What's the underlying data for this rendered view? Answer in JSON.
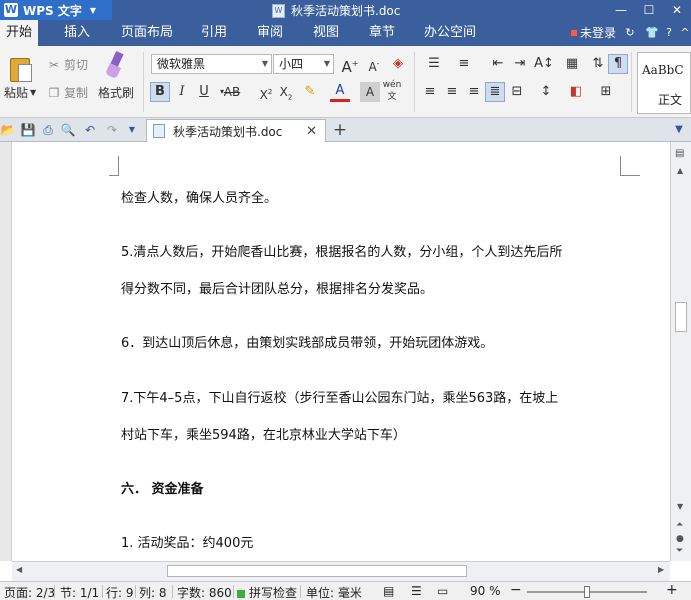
{
  "titlebar": {
    "app_logo": "W",
    "app_name": "WPS 文字",
    "doc_title": "秋季活动策划书.doc",
    "window_controls": [
      "minimize-icon",
      "maximize-icon",
      "close-icon"
    ]
  },
  "menubar": {
    "tabs": [
      "开始",
      "插入",
      "页面布局",
      "引用",
      "审阅",
      "视图",
      "章节",
      "办公空间"
    ],
    "login_label": "未登录"
  },
  "ribbon": {
    "paste_label": "粘贴",
    "cut_label": "剪切",
    "copy_label": "复制",
    "format_painter_label": "格式刷",
    "font_name": "微软雅黑",
    "font_size": "小四",
    "style_sample": "AaBbC",
    "style_name": "正文"
  },
  "document_tab": {
    "title": "秋季活动策划书.doc"
  },
  "document": {
    "paragraphs": [
      "检查人数，确保人员齐全。",
      "5.清点人数后，开始爬香山比赛，根据报名的人数，分小组，个人到达先后所",
      "得分数不同，最后合计团队总分，根据排名分发奖品。",
      "6．到达山顶后休息，由策划实践部成员带领，开始玩团体游戏。",
      "7.下午4–5点，下山自行返校（步行至香山公园东门站，乘坐563路，在坡上",
      "村站下车，乘坐594路，在北京林业大学站下车）",
      "六．  资金准备",
      "1. 活动奖品：约400元"
    ]
  },
  "statusbar": {
    "page": "页面: 2/3",
    "section": "节: 1/1",
    "row": "行: 9",
    "col": "列: 8",
    "word_count": "字数: 860",
    "spell_check": "拼写检查",
    "unit": "单位: 毫米",
    "zoom": "90 %",
    "zoom_level": 0.5
  },
  "colors": {
    "title_bar": "#3a5f9c",
    "app_button": "#2f6fc9",
    "ribbon_bg": "#f3f3f3"
  }
}
